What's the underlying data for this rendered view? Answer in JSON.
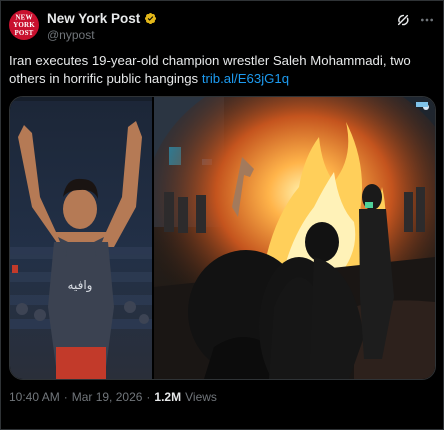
{
  "author": {
    "display_name": "New York Post",
    "handle": "@nypost",
    "avatar_text": "NEW YORK POST",
    "verified": true
  },
  "tweet": {
    "text": "Iran executes 19-year-old champion wrestler Saleh Mohammadi, two others in horrific public hangings",
    "link": "trib.al/E63jG1q"
  },
  "meta": {
    "time": "10:40 AM",
    "separator": "·",
    "date": "Mar 19, 2026",
    "views_count": "1.2M",
    "views_label": "Views"
  },
  "colors": {
    "accent": "#1d9bf0",
    "brand": "#c8102e",
    "muted": "#71767b",
    "text": "#e7e9ea"
  }
}
